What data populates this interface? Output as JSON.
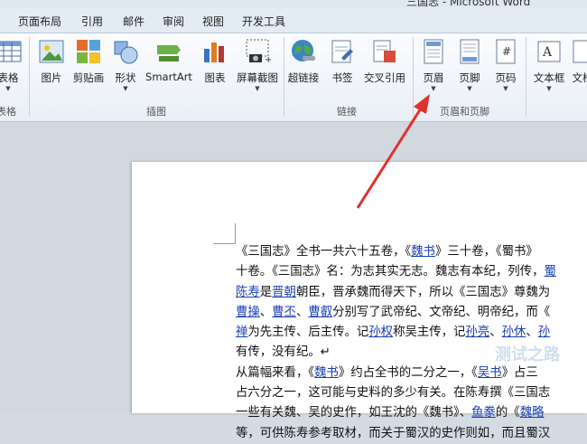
{
  "window": {
    "title": "三国志 - Microsoft Word"
  },
  "tabs": [
    "页面布局",
    "引用",
    "邮件",
    "审阅",
    "视图",
    "开发工具"
  ],
  "ribbon": {
    "buttons": [
      {
        "label": "表格",
        "icon": "table-icon",
        "dropdown": true
      },
      {
        "label": "图片",
        "icon": "picture-icon",
        "dropdown": false
      },
      {
        "label": "剪贴画",
        "icon": "clipart-icon",
        "dropdown": false
      },
      {
        "label": "形状",
        "icon": "shapes-icon",
        "dropdown": true
      },
      {
        "label": "SmartArt",
        "icon": "smartart-icon",
        "dropdown": false
      },
      {
        "label": "图表",
        "icon": "chart-icon",
        "dropdown": false
      },
      {
        "label": "屏幕截图",
        "icon": "screenshot-icon",
        "dropdown": true
      },
      {
        "label": "超链接",
        "icon": "hyperlink-globe-icon",
        "dropdown": false
      },
      {
        "label": "书签",
        "icon": "bookmark-icon",
        "dropdown": false
      },
      {
        "label": "交叉引用",
        "icon": "cross-reference-icon",
        "dropdown": false
      },
      {
        "label": "页眉",
        "icon": "header-icon",
        "dropdown": true
      },
      {
        "label": "页脚",
        "icon": "footer-icon",
        "dropdown": true
      },
      {
        "label": "页码",
        "icon": "page-number-icon",
        "dropdown": true
      },
      {
        "label": "文本框",
        "icon": "textbox-icon",
        "dropdown": true
      },
      {
        "label": "文档",
        "icon": "document-parts-icon",
        "dropdown": false
      }
    ],
    "groups": [
      "表格",
      "插图",
      "链接",
      "页眉和页脚"
    ]
  },
  "document": {
    "lines": [
      [
        {
          "t": "《三国志》全书一共六十五卷，《"
        },
        {
          "t": "魏书",
          "link": true
        },
        {
          "t": "》三十卷，《蜀书》"
        }
      ],
      [
        {
          "t": "十卷。《三国志》名：为志其实无志。魏志有本纪，列传，"
        },
        {
          "t": "蜀",
          "link": true
        }
      ],
      [
        {
          "t": "陈寿",
          "link": true
        },
        {
          "t": "是"
        },
        {
          "t": "晋朝",
          "link": true
        },
        {
          "t": "朝臣，晋承魏而得天下，所以《三国志》尊魏为"
        }
      ],
      [
        {
          "t": "曹操",
          "link": true
        },
        {
          "t": "、"
        },
        {
          "t": "曹丕",
          "link": true
        },
        {
          "t": "、"
        },
        {
          "t": "曹叡",
          "link": true
        },
        {
          "t": "分别写了武帝纪、文帝纪、明帝纪，而《"
        }
      ],
      [
        {
          "t": "禅",
          "link": true
        },
        {
          "t": "为先主传、后主传。记"
        },
        {
          "t": "孙权",
          "link": true
        },
        {
          "t": "称吴主传，记"
        },
        {
          "t": "孙亮",
          "link": true
        },
        {
          "t": "、"
        },
        {
          "t": "孙休",
          "link": true
        },
        {
          "t": "、"
        },
        {
          "t": "孙",
          "link": true
        }
      ],
      [
        {
          "t": "有传，没有纪。↵"
        }
      ],
      [
        {
          "t": "从篇幅来看，《"
        },
        {
          "t": "魏书",
          "link": true
        },
        {
          "t": "》约占全书的二分之一，《"
        },
        {
          "t": "吴书",
          "link": true
        },
        {
          "t": "》占三"
        }
      ],
      [
        {
          "t": "占六分之一，这可能与史料的多少有关。在陈寿撰《三国志"
        }
      ],
      [
        {
          "t": "一些有关魏、吴的史作，如王沈的《魏书》、"
        },
        {
          "t": "鱼豢",
          "link": true
        },
        {
          "t": "的《"
        },
        {
          "t": "魏略",
          "link": true
        }
      ],
      [
        {
          "t": "等，可供陈寿参考取材，而关于蜀汉的史作则如，而且蜀汉"
        }
      ]
    ]
  },
  "watermark": "测试之路"
}
